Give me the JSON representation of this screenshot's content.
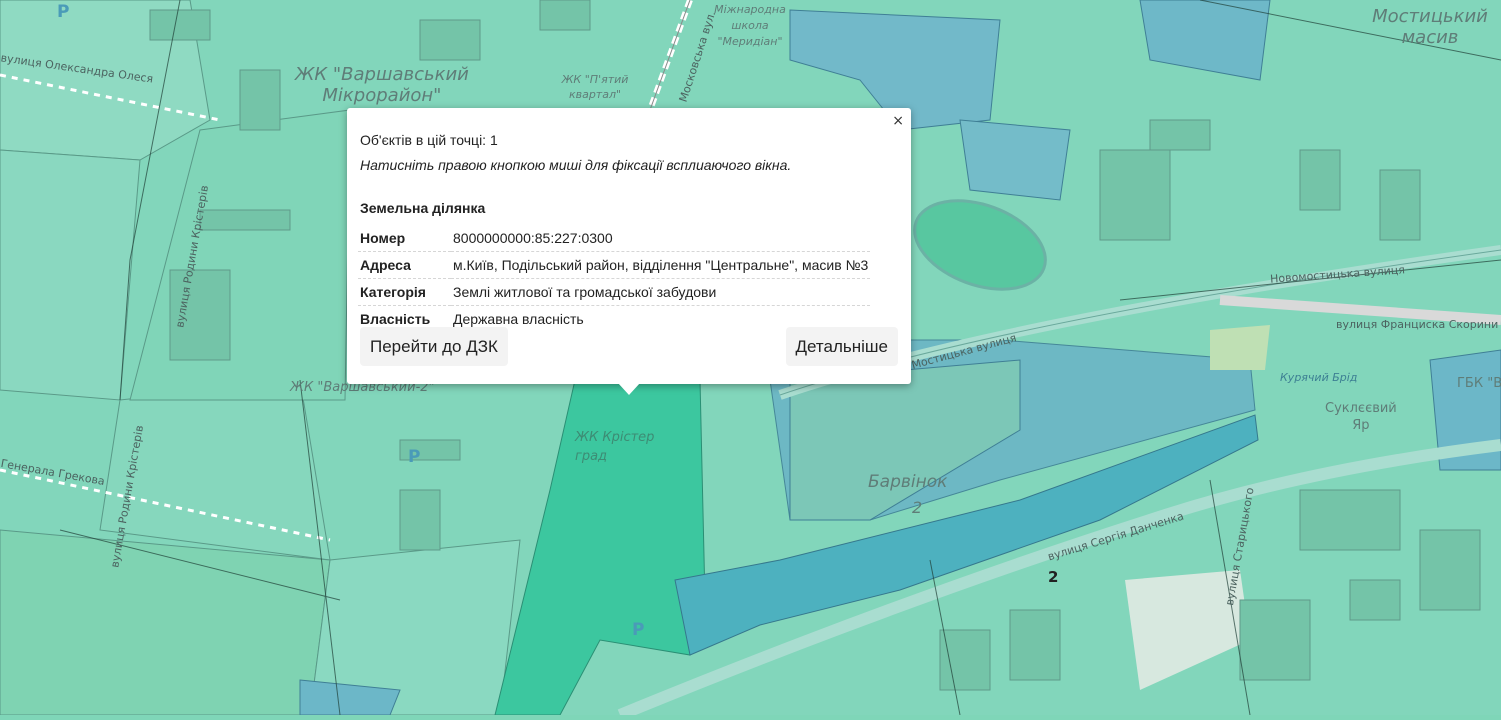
{
  "map": {
    "labels": {
      "zhk_varshavskyi": "ЖК \"Варшавський\nМікрорайон\"",
      "zhk_varshavskyi2": "ЖК \"Варшавський-2\"",
      "zhk_p_yatyi": "ЖК \"П'ятий\nквартал\"",
      "school": "Міжнародна\nшкола\n\"Меридіан\"",
      "mostytskyi": "Мостицький\nмасив",
      "barvinok": "Барвінок",
      "barvinok_num": "2",
      "kuriachyi_brid": "Курячий Брід",
      "suklieievyi": "Суклєєвий\nЯр",
      "gbk": "ГБК \"В",
      "zhk_krister": "ЖК Крістер\nград",
      "street_olesia": "вулиця Олександра Олеся",
      "street_kristeriv": "вулиця Родини Крістерів",
      "street_kristeriv2": "вулиця Родини Крістерів",
      "street_grekova": "Генерала Грекова",
      "street_novomostytska": "Новомостицька вулиця",
      "street_novomostytska2": "Мостицька вулиця",
      "street_skoryny": "вулиця Франциска Скорини",
      "street_danchenka": "вулиця Сергія Данченка",
      "street_starytskoho": "вулиця Старицького",
      "parking": "P",
      "marker_num": "2",
      "moskovska": "Московська вул."
    }
  },
  "popup": {
    "close": "×",
    "count_text": "Об'єктів в цій точці: 1",
    "hint": "Натисніть правою кнопкою миші для фіксації всплиаючого вікна.",
    "feature_title": "Земельна ділянка",
    "rows": [
      {
        "key": "Номер",
        "value": "8000000000:85:227:0300"
      },
      {
        "key": "Адреса",
        "value": "м.Київ, Подільський район, відділення \"Центральне\", масив №3"
      },
      {
        "key": "Категорія",
        "value": "Землі житлової та громадської забудови"
      },
      {
        "key": "Власність",
        "value": "Державна власність"
      }
    ],
    "btn_dzk": "Перейти до ДЗК",
    "btn_details": "Детальніше"
  }
}
